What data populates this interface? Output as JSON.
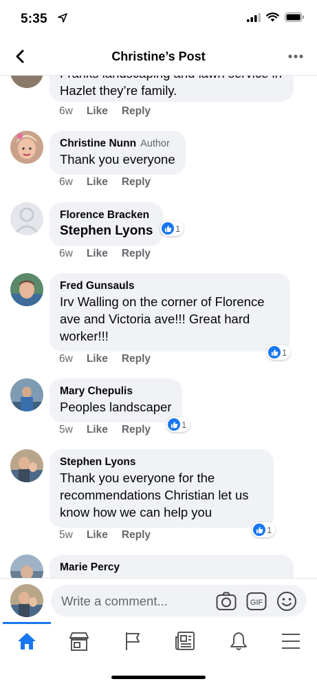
{
  "status": {
    "time": "5:35"
  },
  "header": {
    "title": "Christine’s Post"
  },
  "comments": [
    {
      "text": "Franks landscaping and lawn service in Hazlet they’re family.",
      "time": "6w",
      "like": "Like",
      "reply": "Reply"
    },
    {
      "author": "Christine Nunn",
      "badge": "Author",
      "text": "Thank you everyone",
      "time": "6w",
      "like": "Like",
      "reply": "Reply"
    },
    {
      "author": "Florence Bracken",
      "text": "Stephen Lyons",
      "time": "6w",
      "like": "Like",
      "reply": "Reply",
      "reactions": "1"
    },
    {
      "author": "Fred Gunsauls",
      "text": "Irv Walling on the corner of Florence ave and Victoria ave!!! Great hard worker!!!",
      "time": "6w",
      "like": "Like",
      "reply": "Reply",
      "reactions": "1"
    },
    {
      "author": "Mary Chepulis",
      "text": "Peoples landscaper",
      "time": "5w",
      "like": "Like",
      "reply": "Reply",
      "reactions": "1"
    },
    {
      "author": "Stephen Lyons",
      "text": "Thank you everyone for the recommendations Christian let us know how we can help you",
      "time": "5w",
      "like": "Like",
      "reply": "Reply",
      "reactions": "1"
    },
    {
      "author": "Marie Percy"
    }
  ],
  "composer": {
    "placeholder": "Write a comment..."
  },
  "colors": {
    "accent": "#1877f2",
    "bubble": "#f0f2f5",
    "muted": "#65676b"
  }
}
